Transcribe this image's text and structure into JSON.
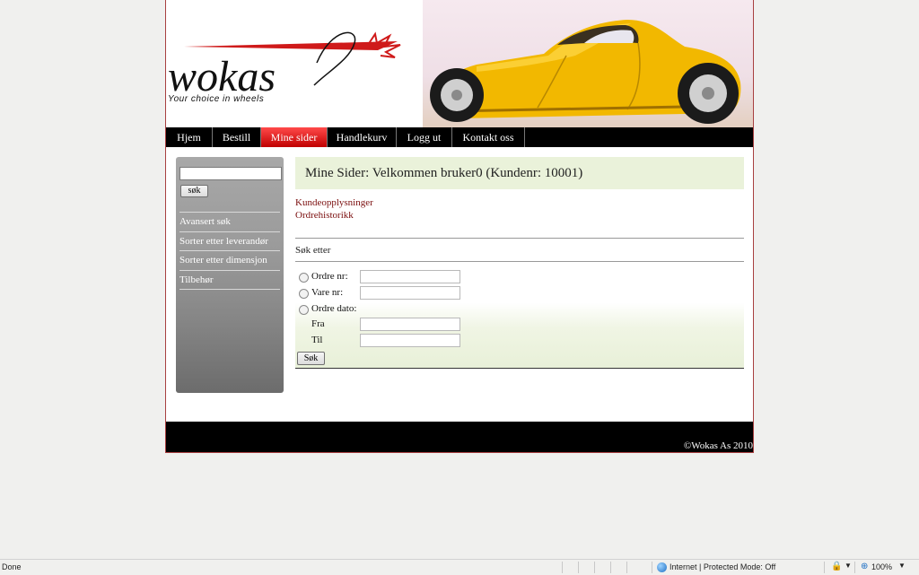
{
  "header": {
    "logo_text": "wokas",
    "tagline": "Your choice in wheels"
  },
  "nav": [
    {
      "label": "Hjem",
      "active": false
    },
    {
      "label": "Bestill",
      "active": false
    },
    {
      "label": "Mine sider",
      "active": true
    },
    {
      "label": "Handlekurv",
      "active": false
    },
    {
      "label": "Logg ut",
      "active": false
    },
    {
      "label": "Kontakt oss",
      "active": false
    }
  ],
  "sidebar": {
    "search_value": "",
    "search_button": "søk",
    "links": [
      "Avansert søk",
      "Sorter etter leverandør",
      "Sorter etter dimensjon",
      "Tilbehør"
    ]
  },
  "main": {
    "welcome": "Mine Sider: Velkommen bruker0 (Kundenr: 10001)",
    "account_links": [
      "Kundeopplysninger",
      "Ordrehistorikk"
    ],
    "search_title": "Søk etter",
    "search": {
      "order_no_label": "Ordre nr:",
      "item_no_label": "Vare nr:",
      "order_date_label": "Ordre dato:",
      "from_label": "Fra",
      "to_label": "Til",
      "button": "Søk"
    }
  },
  "footer": {
    "copyright": "©Wokas As 2010"
  },
  "statusbar": {
    "left": "Done",
    "zone": "Internet | Protected Mode: Off",
    "zoom": "100%"
  },
  "colors": {
    "nav_bg": "#000000",
    "nav_active": "#e01010",
    "link": "#7a0d0d",
    "welcome_bg": "#eaf2da",
    "car_yellow": "#f2b800"
  }
}
